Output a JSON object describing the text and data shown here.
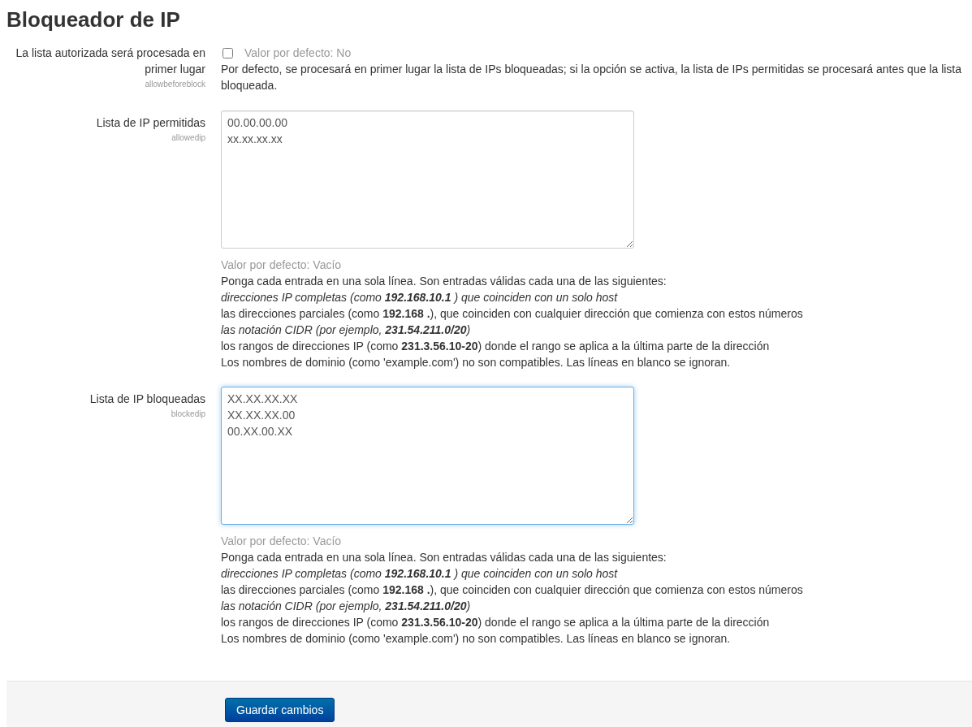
{
  "title": "Bloqueador de IP",
  "settings": [
    {
      "kind": "checkbox",
      "label": "La lista autorizada será procesada en primer lugar",
      "name": "allowbeforeblock",
      "checked": false,
      "default": "Valor por defecto: No",
      "description": "Por defecto, se procesará en primer lugar la lista de IPs bloqueadas; si la opción se activa, la lista de IPs permitidas se procesará antes que la lista bloqueada."
    },
    {
      "kind": "textarea",
      "label": "Lista de IP permitidas",
      "name": "allowedip",
      "focused": false,
      "value": "00.00.00.00\nxx.xx.xx.xx",
      "default": "Valor por defecto: Vacío",
      "help": [
        {
          "text": "Ponga cada entrada en una sola línea. Son entradas válidas cada una de las siguientes:",
          "italic": false
        },
        {
          "text": "direcciones IP completas (como **192.168.10.1** ) que coinciden con un solo host",
          "italic": true
        },
        {
          "text": "las direcciones parciales (como **192.168 .**), que coinciden con cualquier dirección que comienza con estos números",
          "italic": false
        },
        {
          "text": "las notación CIDR (por ejemplo, **231.54.211.0/20**)",
          "italic": true
        },
        {
          "text": "los rangos de direcciones IP (como **231.3.56.10-20**) donde el rango se aplica a la última parte de la dirección",
          "italic": false
        },
        {
          "text": "Los nombres de dominio (como 'example.com') no son compatibles. Las líneas en blanco se ignoran.",
          "italic": false
        }
      ]
    },
    {
      "kind": "textarea",
      "label": "Lista de IP bloqueadas",
      "name": "blockedip",
      "focused": true,
      "value": "XX.XX.XX.XX\nXX.XX.XX.00\n00.XX.00.XX",
      "default": "Valor por defecto: Vacío",
      "help": [
        {
          "text": "Ponga cada entrada en una sola línea. Son entradas válidas cada una de las siguientes:",
          "italic": false
        },
        {
          "text": "direcciones IP completas (como **192.168.10.1** ) que coinciden con un solo host",
          "italic": true
        },
        {
          "text": "las direcciones parciales (como **192.168 .**), que coinciden con cualquier dirección que comienza con estos números",
          "italic": false
        },
        {
          "text": "las notación CIDR (por ejemplo, **231.54.211.0/20**)",
          "italic": true
        },
        {
          "text": "los rangos de direcciones IP (como **231.3.56.10-20**) donde el rango se aplica a la última parte de la dirección",
          "italic": false
        },
        {
          "text": "Los nombres de dominio (como 'example.com') no son compatibles. Las líneas en blanco se ignoran.",
          "italic": false
        }
      ]
    }
  ],
  "save_button": "Guardar cambios"
}
